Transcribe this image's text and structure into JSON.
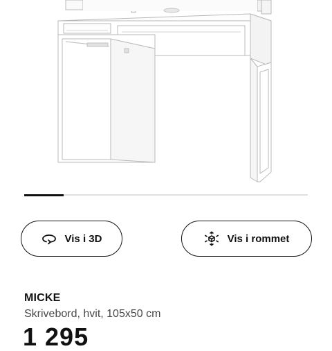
{
  "product": {
    "name": "MICKE",
    "description": "Skrivebord, hvit, 105x50 cm",
    "price_partial": "1 295"
  },
  "carousel": {
    "current_index": 1,
    "progress_fraction": 0.14
  },
  "actions": {
    "view_3d": {
      "label": "Vis i 3D",
      "icon": "rotate-3d-icon"
    },
    "view_in_room": {
      "label": "Vis i rommet",
      "icon": "ar-cube-icon"
    }
  },
  "colors": {
    "text": "#111111",
    "secondary_text": "#484848",
    "track": "#dfdfdf",
    "background": "#ffffff"
  }
}
